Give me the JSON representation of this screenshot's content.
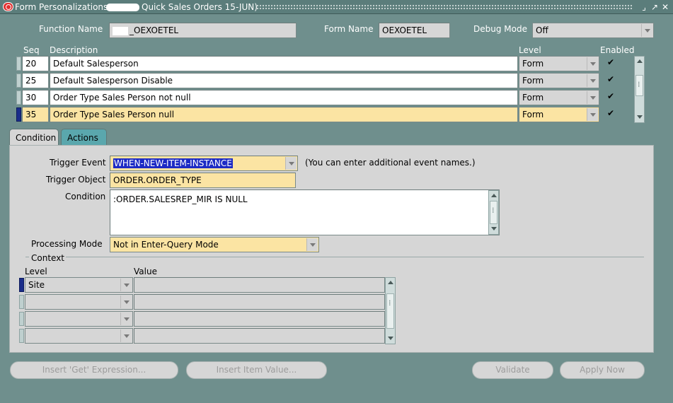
{
  "window": {
    "title_prefix": "Form Personalizations",
    "title_suffix": "Quick Sales Orders 15-JUN)",
    "controls": [
      "⌟",
      "↗",
      "✕"
    ]
  },
  "header": {
    "function_name_label": "Function Name",
    "function_name_value": "_OEXOETEL",
    "form_name_label": "Form Name",
    "form_name_value": "OEXOETEL",
    "debug_mode_label": "Debug Mode",
    "debug_mode_value": "Off"
  },
  "rules_table": {
    "columns": {
      "seq": "Seq",
      "description": "Description",
      "level": "Level",
      "enabled": "Enabled"
    },
    "rows": [
      {
        "seq": "20",
        "description": "Default Salesperson",
        "level": "Form",
        "enabled": "✔"
      },
      {
        "seq": "25",
        "description": "Default Salesperson Disable",
        "level": "Form",
        "enabled": "✔"
      },
      {
        "seq": "30",
        "description": "Order Type Sales Person not null",
        "level": "Form",
        "enabled": "✔"
      },
      {
        "seq": "35",
        "description": "Order Type Sales Person null",
        "level": "Form",
        "enabled": "✔"
      }
    ]
  },
  "tabs": {
    "condition": "Condition",
    "actions": "Actions"
  },
  "condition": {
    "trigger_event_label": "Trigger Event",
    "trigger_event_value": "WHEN-NEW-ITEM-INSTANCE",
    "trigger_event_hint": "(You can enter additional event names.)",
    "trigger_object_label": "Trigger Object",
    "trigger_object_value": "ORDER.ORDER_TYPE",
    "condition_label": "Condition",
    "condition_value": ":ORDER.SALESREP_MIR IS NULL",
    "processing_mode_label": "Processing Mode",
    "processing_mode_value": "Not in Enter-Query Mode"
  },
  "context": {
    "title": "Context",
    "level_header": "Level",
    "value_header": "Value",
    "rows": [
      {
        "level": "Site",
        "value": ""
      },
      {
        "level": "",
        "value": ""
      },
      {
        "level": "",
        "value": ""
      },
      {
        "level": "",
        "value": ""
      }
    ]
  },
  "buttons": {
    "insert_get": "Insert 'Get' Expression...",
    "insert_item": "Insert Item Value...",
    "validate": "Validate",
    "apply_now": "Apply Now"
  },
  "colors": {
    "background": "#6f8f8d",
    "highlight_row": "#fbe4a3",
    "panel": "#d6d6d6",
    "selection": "#1d2bc5"
  }
}
